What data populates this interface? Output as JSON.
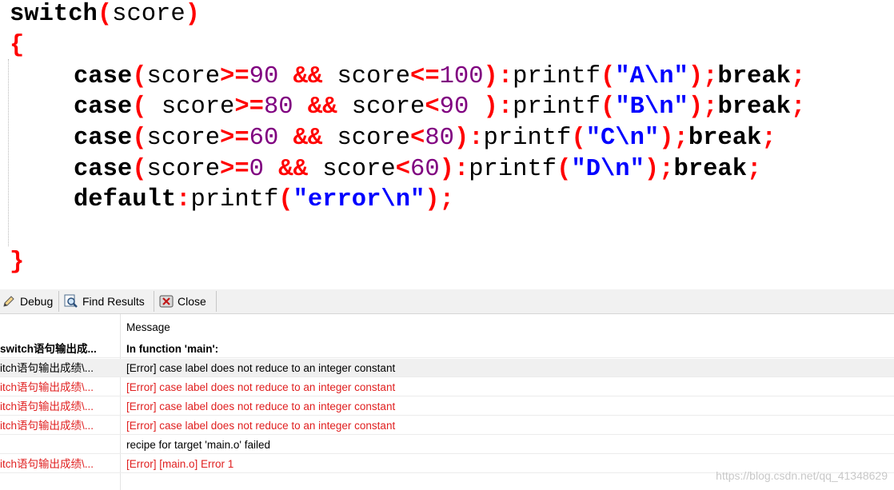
{
  "editor": {
    "lines": [
      [
        {
          "t": "switch",
          "c": "kw"
        },
        {
          "t": "(",
          "c": "sym"
        },
        {
          "t": "score",
          "c": "id"
        },
        {
          "t": ")",
          "c": "sym"
        }
      ],
      [
        {
          "t": "{",
          "c": "sym"
        }
      ],
      [
        {
          "t": "case",
          "c": "kw"
        },
        {
          "t": "(",
          "c": "sym"
        },
        {
          "t": "score",
          "c": "id"
        },
        {
          "t": ">=",
          "c": "op"
        },
        {
          "t": "90",
          "c": "num"
        },
        {
          "t": " ",
          "c": "id"
        },
        {
          "t": "&&",
          "c": "op"
        },
        {
          "t": " score",
          "c": "id"
        },
        {
          "t": "<=",
          "c": "op"
        },
        {
          "t": "100",
          "c": "num"
        },
        {
          "t": "):",
          "c": "sym"
        },
        {
          "t": "printf",
          "c": "id"
        },
        {
          "t": "(",
          "c": "sym"
        },
        {
          "t": "\"A\\n\"",
          "c": "str"
        },
        {
          "t": ");",
          "c": "sym"
        },
        {
          "t": "break",
          "c": "kw"
        },
        {
          "t": ";",
          "c": "sym"
        }
      ],
      [
        {
          "t": "case",
          "c": "kw"
        },
        {
          "t": "(",
          "c": "sym"
        },
        {
          "t": " score",
          "c": "id"
        },
        {
          "t": ">=",
          "c": "op"
        },
        {
          "t": "80",
          "c": "num"
        },
        {
          "t": " ",
          "c": "id"
        },
        {
          "t": "&&",
          "c": "op"
        },
        {
          "t": " score",
          "c": "id"
        },
        {
          "t": "<",
          "c": "op"
        },
        {
          "t": "90",
          "c": "num"
        },
        {
          "t": " ",
          "c": "id"
        },
        {
          "t": "):",
          "c": "sym"
        },
        {
          "t": "printf",
          "c": "id"
        },
        {
          "t": "(",
          "c": "sym"
        },
        {
          "t": "\"B\\n\"",
          "c": "str"
        },
        {
          "t": ");",
          "c": "sym"
        },
        {
          "t": "break",
          "c": "kw"
        },
        {
          "t": ";",
          "c": "sym"
        }
      ],
      [
        {
          "t": "case",
          "c": "kw"
        },
        {
          "t": "(",
          "c": "sym"
        },
        {
          "t": "score",
          "c": "id"
        },
        {
          "t": ">=",
          "c": "op"
        },
        {
          "t": "60",
          "c": "num"
        },
        {
          "t": " ",
          "c": "id"
        },
        {
          "t": "&&",
          "c": "op"
        },
        {
          "t": " score",
          "c": "id"
        },
        {
          "t": "<",
          "c": "op"
        },
        {
          "t": "80",
          "c": "num"
        },
        {
          "t": "):",
          "c": "sym"
        },
        {
          "t": "printf",
          "c": "id"
        },
        {
          "t": "(",
          "c": "sym"
        },
        {
          "t": "\"C\\n\"",
          "c": "str"
        },
        {
          "t": ");",
          "c": "sym"
        },
        {
          "t": "break",
          "c": "kw"
        },
        {
          "t": ";",
          "c": "sym"
        }
      ],
      [
        {
          "t": "case",
          "c": "kw"
        },
        {
          "t": "(",
          "c": "sym"
        },
        {
          "t": "score",
          "c": "id"
        },
        {
          "t": ">=",
          "c": "op"
        },
        {
          "t": "0",
          "c": "num"
        },
        {
          "t": " ",
          "c": "id"
        },
        {
          "t": "&&",
          "c": "op"
        },
        {
          "t": " score",
          "c": "id"
        },
        {
          "t": "<",
          "c": "op"
        },
        {
          "t": "60",
          "c": "num"
        },
        {
          "t": "):",
          "c": "sym"
        },
        {
          "t": "printf",
          "c": "id"
        },
        {
          "t": "(",
          "c": "sym"
        },
        {
          "t": "\"D\\n\"",
          "c": "str"
        },
        {
          "t": ");",
          "c": "sym"
        },
        {
          "t": "break",
          "c": "kw"
        },
        {
          "t": ";",
          "c": "sym"
        }
      ],
      [
        {
          "t": "default",
          "c": "kw"
        },
        {
          "t": ":",
          "c": "sym"
        },
        {
          "t": "printf",
          "c": "id"
        },
        {
          "t": "(",
          "c": "sym"
        },
        {
          "t": "\"error\\n\"",
          "c": "str"
        },
        {
          "t": ");",
          "c": "sym"
        }
      ],
      [],
      [
        {
          "t": "}",
          "c": "sym"
        }
      ]
    ]
  },
  "tabs": [
    {
      "label": "Debug",
      "icon": "pencil-icon"
    },
    {
      "label": "Find Results",
      "icon": "magnifier-icon"
    },
    {
      "label": "Close",
      "icon": "close-icon"
    }
  ],
  "messages": {
    "column_header": "Message",
    "rows": [
      {
        "file": "switch语句输出成...",
        "msg": "In function 'main':",
        "kind": "bold"
      },
      {
        "file": "itch语句输出成绩\\...",
        "msg": "[Error] case label does not reduce to an integer constant",
        "kind": "selected"
      },
      {
        "file": "itch语句输出成绩\\...",
        "msg": "[Error] case label does not reduce to an integer constant",
        "kind": "err"
      },
      {
        "file": "itch语句输出成绩\\...",
        "msg": "[Error] case label does not reduce to an integer constant",
        "kind": "err"
      },
      {
        "file": "itch语句输出成绩\\...",
        "msg": "[Error] case label does not reduce to an integer constant",
        "kind": "err"
      },
      {
        "file": "",
        "msg": "recipe for target 'main.o' failed",
        "kind": "plain"
      },
      {
        "file": "itch语句输出成绩\\...",
        "msg": "[Error] [main.o] Error 1",
        "kind": "err"
      }
    ]
  },
  "watermark": "https://blog.csdn.net/qq_41348629"
}
